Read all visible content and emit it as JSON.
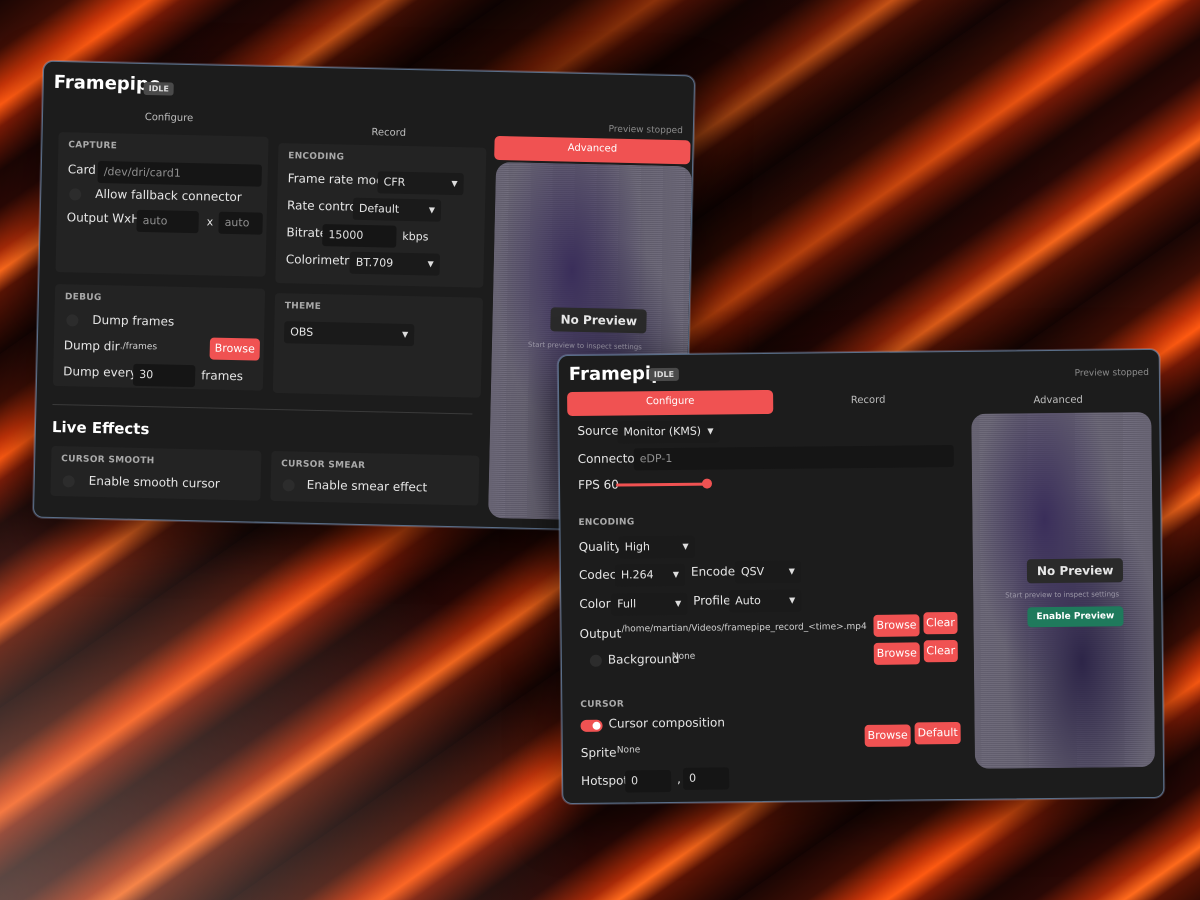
{
  "window_back": {
    "title": "Framepipe",
    "badge": "IDLE",
    "preview_status": "Preview stopped",
    "tabs": [
      "Configure",
      "Record",
      "Advanced"
    ],
    "active_tab": "Advanced",
    "capture": {
      "heading": "CAPTURE",
      "card_label": "Card",
      "card_placeholder": "/dev/dri/card1",
      "fallback_label": "Allow fallback connector",
      "output_label": "Output WxH",
      "width_placeholder": "auto",
      "x_sep": "x",
      "height_placeholder": "auto"
    },
    "encoding": {
      "heading": "ENCODING",
      "frame_rate_mode_label": "Frame rate mode",
      "frame_rate_mode_value": "CFR",
      "rate_control_label": "Rate control",
      "rate_control_value": "Default",
      "bitrate_label": "Bitrate",
      "bitrate_value": "15000",
      "bitrate_unit": "kbps",
      "colorimetry_label": "Colorimetry",
      "colorimetry_value": "BT.709"
    },
    "debug": {
      "heading": "DEBUG",
      "dump_frames_label": "Dump frames",
      "dump_dir_label": "Dump dir",
      "dump_dir_value": "./frames",
      "browse_label": "Browse",
      "dump_every_label": "Dump every",
      "dump_every_value": "30",
      "dump_every_unit": "frames"
    },
    "theme": {
      "heading": "THEME",
      "value": "OBS"
    },
    "live_effects": {
      "heading": "Live Effects",
      "cursor_smooth_heading": "CURSOR SMOOTH",
      "cursor_smooth_label": "Enable smooth cursor",
      "cursor_smear_heading": "CURSOR SMEAR",
      "cursor_smear_label": "Enable smear effect"
    },
    "preview": {
      "no_preview": "No Preview",
      "hint": "Start preview to inspect settings"
    }
  },
  "window_front": {
    "title": "Framepipe",
    "badge": "IDLE",
    "preview_status": "Preview stopped",
    "tabs": [
      "Configure",
      "Record",
      "Advanced"
    ],
    "active_tab": "Configure",
    "source_label": "Source",
    "source_value": "Monitor (KMS)",
    "connector_label": "Connector",
    "connector_placeholder": "eDP-1",
    "fps_label": "FPS 60",
    "fps_value": 60,
    "encoding": {
      "heading": "ENCODING",
      "quality_label": "Quality",
      "quality_value": "High",
      "codec_label": "Codec",
      "codec_value": "H.264",
      "encoder_label": "Encoder",
      "encoder_value": "QSV",
      "color_label": "Color",
      "color_value": "Full",
      "profile_label": "Profile",
      "profile_value": "Auto",
      "output_label": "Output",
      "output_value": "/home/martian/Videos/framepipe_record_<time>.mp4",
      "browse_label": "Browse",
      "clear_label": "Clear",
      "background_label": "Background",
      "background_value": "None"
    },
    "cursor": {
      "heading": "CURSOR",
      "composition_label": "Cursor composition",
      "sprite_label": "Sprite",
      "sprite_value": "None",
      "browse_label": "Browse",
      "default_label": "Default",
      "hotspot_label": "Hotspot",
      "hotspot_x": "0",
      "hotspot_sep": ",",
      "hotspot_y": "0"
    },
    "preview": {
      "no_preview": "No Preview",
      "hint": "Start preview to inspect settings",
      "enable_label": "Enable Preview"
    }
  },
  "colors": {
    "accent": "#f05252",
    "window_bg": "#1c1c1c",
    "panel_bg": "#232323",
    "enable_green": "#1f7a5c"
  }
}
